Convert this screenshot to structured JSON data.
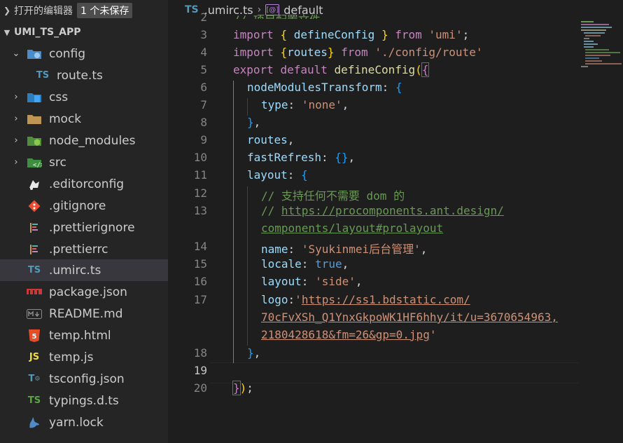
{
  "sidebar": {
    "open_editors_label": "打开的编辑器",
    "unsaved_badge": "1 个未保存",
    "project_name": "UMI_TS_APP",
    "items": [
      {
        "label": "config",
        "icon": "config-folder-icon",
        "kind": "folder-open"
      },
      {
        "label": "route.ts",
        "icon": "ts-file-icon",
        "icon_text": "TS",
        "kind": "file"
      },
      {
        "label": "css",
        "icon": "css-folder-icon",
        "kind": "folder"
      },
      {
        "label": "mock",
        "icon": "folder-icon",
        "kind": "folder"
      },
      {
        "label": "node_modules",
        "icon": "node-folder-icon",
        "kind": "folder"
      },
      {
        "label": "src",
        "icon": "src-folder-icon",
        "kind": "folder"
      },
      {
        "label": ".editorconfig",
        "icon": "editorconfig-icon",
        "kind": "file"
      },
      {
        "label": ".gitignore",
        "icon": "git-icon",
        "kind": "file"
      },
      {
        "label": ".prettierignore",
        "icon": "prettier-icon",
        "kind": "file"
      },
      {
        "label": ".prettierrc",
        "icon": "prettier-icon",
        "kind": "file"
      },
      {
        "label": ".umirc.ts",
        "icon": "ts-file-icon",
        "icon_text": "TS",
        "kind": "file",
        "active": true
      },
      {
        "label": "package.json",
        "icon": "npm-icon",
        "kind": "file"
      },
      {
        "label": "README.md",
        "icon": "markdown-icon",
        "kind": "file"
      },
      {
        "label": "temp.html",
        "icon": "html-icon",
        "kind": "file"
      },
      {
        "label": "temp.js",
        "icon": "js-file-icon",
        "icon_text": "JS",
        "kind": "file"
      },
      {
        "label": "tsconfig.json",
        "icon": "tsconfig-icon",
        "icon_text": "T",
        "kind": "file"
      },
      {
        "label": "typings.d.ts",
        "icon": "ts-file-icon",
        "icon_text": "TS",
        "kind": "file"
      },
      {
        "label": "yarn.lock",
        "icon": "yarn-icon",
        "kind": "file"
      }
    ]
  },
  "editor": {
    "breadcrumb": {
      "file_icon_text": "TS",
      "file": ".umirc.ts",
      "symbol": "default"
    },
    "line_numbers": [
      "2",
      "3",
      "4",
      "5",
      "6",
      "7",
      "8",
      "9",
      "10",
      "11",
      "12",
      "13",
      "14",
      "15",
      "16",
      "17",
      "18",
      "19",
      "20"
    ],
    "active_line": "18",
    "code": {
      "l1": "// 项目配置文件",
      "l2_import": "import",
      "l2_open": "{",
      "l2_name": "defineConfig",
      "l2_close": "}",
      "l2_from": "from",
      "l2_str": "'umi'",
      "l2_end": ";",
      "l3_import": "import",
      "l3_open": "{",
      "l3_name": "routes",
      "l3_close": "}",
      "l3_from": "from",
      "l3_str": "'./config/route'",
      "l4_export": "export",
      "l4_default": "default",
      "l4_fn": "defineConfig",
      "l4_paren": "(",
      "l4_brace": "{",
      "l5_prop": "nodeModulesTransform",
      "l5_colon": ":",
      "l5_brace": "{",
      "l6_prop": "type",
      "l6_colon": ":",
      "l6_str": "'none'",
      "l6_comma": ",",
      "l7_brace": "}",
      "l7_comma": ",",
      "l8_prop": "routes",
      "l8_comma": ",",
      "l9_prop": "fastRefresh",
      "l9_colon": ":",
      "l9_braces": "{}",
      "l9_comma": ",",
      "l10_prop": "layout",
      "l10_colon": ":",
      "l10_brace": "{",
      "l11_cmt": "// 支持任何不需要 dom 的",
      "l12_cmt": "//",
      "l12_link_a": "https://procomponents.ant.design/",
      "l12_link_b": "components/layout#prolayout",
      "l13_prop": "name",
      "l13_colon": ":",
      "l13_str": "'Syukinmei后台管理'",
      "l13_comma": ",",
      "l14_prop": "locale",
      "l14_colon": ":",
      "l14_bool": "true",
      "l14_comma": ",",
      "l15_prop": "layout",
      "l15_colon": ":",
      "l15_str": "'side'",
      "l15_comma": ",",
      "l16_prop": "logo",
      "l16_colon": ":",
      "l16_q1": "'",
      "l16_link_a": "https://ss1.bdstatic.com/",
      "l16_link_b": "70cFvXSh_Q1YnxGkpoWK1HF6hhy/it/u=3670654963,",
      "l16_link_c": "2180428618&fm=26&gp=0.jpg",
      "l16_q2": "'",
      "l17_brace": "}",
      "l17_comma": ",",
      "l19_brace": "}",
      "l19_paren": ")",
      "l19_semi": ";"
    }
  },
  "colors": {
    "sidebar_bg": "#252526",
    "editor_bg": "#1e1e1e",
    "active_row": "#37373d",
    "keyword": "#c586c0",
    "function": "#dcdcaa",
    "string": "#ce9178",
    "property": "#9cdcfe",
    "comment": "#6a9955"
  }
}
